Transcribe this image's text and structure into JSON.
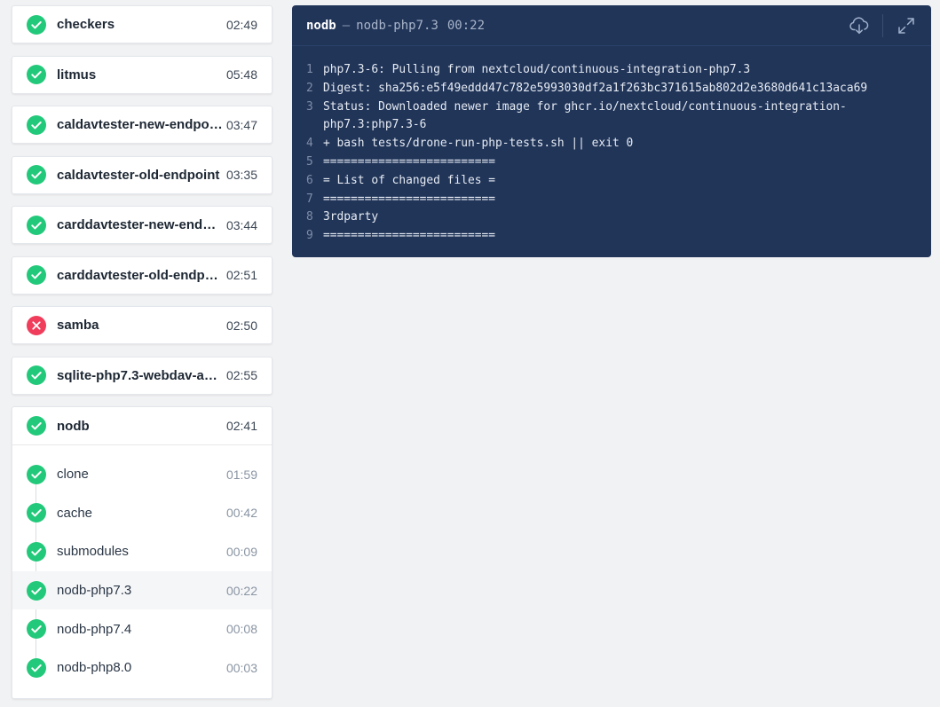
{
  "colors": {
    "success": "#23c97a",
    "failure": "#f03d5b",
    "log_bg": "#213559"
  },
  "pipeline": [
    {
      "name": "checkers",
      "duration": "02:49",
      "status": "success"
    },
    {
      "name": "litmus",
      "duration": "05:48",
      "status": "success"
    },
    {
      "name": "caldavtester-new-endpo…",
      "duration": "03:47",
      "status": "success"
    },
    {
      "name": "caldavtester-old-endpoint",
      "duration": "03:35",
      "status": "success"
    },
    {
      "name": "carddavtester-new-end…",
      "duration": "03:44",
      "status": "success"
    },
    {
      "name": "carddavtester-old-endp…",
      "duration": "02:51",
      "status": "success"
    },
    {
      "name": "samba",
      "duration": "02:50",
      "status": "failure"
    },
    {
      "name": "sqlite-php7.3-webdav-a…",
      "duration": "02:55",
      "status": "success"
    }
  ],
  "expanded": {
    "name": "nodb",
    "duration": "02:41",
    "status": "success",
    "steps": [
      {
        "name": "clone",
        "duration": "01:59"
      },
      {
        "name": "cache",
        "duration": "00:42"
      },
      {
        "name": "submodules",
        "duration": "00:09"
      },
      {
        "name": "nodb-php7.3",
        "duration": "00:22"
      },
      {
        "name": "nodb-php7.4",
        "duration": "00:08"
      },
      {
        "name": "nodb-php8.0",
        "duration": "00:03"
      }
    ]
  },
  "log": {
    "stage": "nodb",
    "separator": "—",
    "step": "nodb-php7.3",
    "duration": "00:22",
    "download_icon": "cloud-download-icon",
    "expand_icon": "expand-icon",
    "lines": [
      {
        "n": "1",
        "text": "php7.3-6: Pulling from nextcloud/continuous-integration-php7.3"
      },
      {
        "n": "2",
        "text": "Digest: sha256:e5f49eddd47c782e5993030df2a1f263bc371615ab802d2e3680d641c13aca69"
      },
      {
        "n": "3",
        "text": "Status: Downloaded newer image for ghcr.io/nextcloud/continuous-integration-\nphp7.3:php7.3-6"
      },
      {
        "n": "4",
        "text": "+ bash tests/drone-run-php-tests.sh || exit 0"
      },
      {
        "n": "5",
        "text": "========================="
      },
      {
        "n": "6",
        "text": "= List of changed files ="
      },
      {
        "n": "7",
        "text": "========================="
      },
      {
        "n": "8",
        "text": "3rdparty"
      },
      {
        "n": "9",
        "text": "========================="
      }
    ]
  }
}
